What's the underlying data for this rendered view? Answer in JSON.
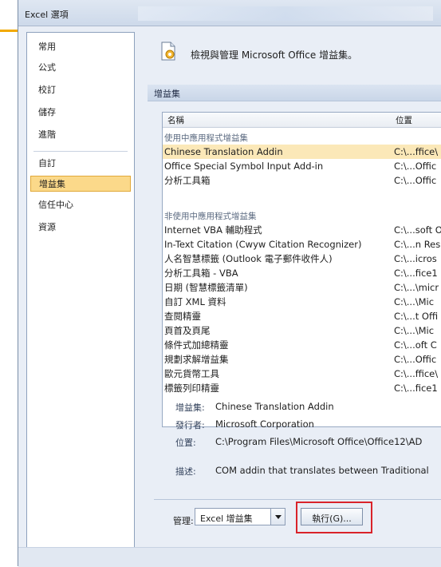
{
  "window": {
    "title": "Excel 選項"
  },
  "nav": {
    "items": [
      {
        "label": "常用"
      },
      {
        "label": "公式"
      },
      {
        "label": "校訂"
      },
      {
        "label": "儲存"
      },
      {
        "label": "進階"
      },
      {
        "label": "自訂"
      },
      {
        "label": "增益集",
        "selected": true
      },
      {
        "label": "信任中心"
      },
      {
        "label": "資源"
      }
    ]
  },
  "header": {
    "text": "檢視與管理 Microsoft Office 增益集。"
  },
  "section": {
    "title": "增益集"
  },
  "list": {
    "columns": {
      "name": "名稱",
      "location": "位置"
    },
    "active_group": "使用中應用程式增益集",
    "active_rows": [
      {
        "name": "Chinese Translation Addin",
        "location": "C:\\...ffice\\",
        "selected": true
      },
      {
        "name": "Office Special Symbol Input Add-in",
        "location": "C:\\...Offic"
      },
      {
        "name": "分析工具箱",
        "location": "C:\\...Offic"
      }
    ],
    "inactive_group": "非使用中應用程式增益集",
    "inactive_rows": [
      {
        "name": "Internet VBA 輔助程式",
        "location": "C:\\...soft O"
      },
      {
        "name": "In-Text Citation (Cwyw Citation Recognizer)",
        "location": "C:\\...n Res"
      },
      {
        "name": "人名智慧標籤 (Outlook 電子郵件收件人)",
        "location": "C:\\...icros"
      },
      {
        "name": "分析工具箱 - VBA",
        "location": "C:\\...fice1"
      },
      {
        "name": "日期 (智慧標籤清單)",
        "location": "C:\\...\\micr"
      },
      {
        "name": "自訂 XML 資料",
        "location": "C:\\...\\Mic"
      },
      {
        "name": "查閱精靈",
        "location": "C:\\...t Offi"
      },
      {
        "name": "頁首及頁尾",
        "location": "C:\\...\\Mic"
      },
      {
        "name": "條件式加總精靈",
        "location": "C:\\...oft C"
      },
      {
        "name": "規劃求解增益集",
        "location": "C:\\...Offic"
      },
      {
        "name": "歐元貨幣工具",
        "location": "C:\\...ffice\\"
      },
      {
        "name": "標籤列印精靈",
        "location": "C:\\...fice1"
      }
    ]
  },
  "details": {
    "addin_label": "增益集:",
    "addin_value": "Chinese Translation Addin",
    "publisher_label": "發行者:",
    "publisher_value": "Microsoft Corporation",
    "location_label": "位置:",
    "location_value": "C:\\Program Files\\Microsoft Office\\Office12\\AD",
    "description_label": "描述:",
    "description_value": "COM addin that translates between Traditional"
  },
  "manage": {
    "label": "管理:",
    "selected_value": "Excel 增益集",
    "go_label": "執行(G)..."
  },
  "colors": {
    "accent": "#f2a900",
    "selection": "#fbd98a",
    "highlight_box": "#d9232a"
  }
}
